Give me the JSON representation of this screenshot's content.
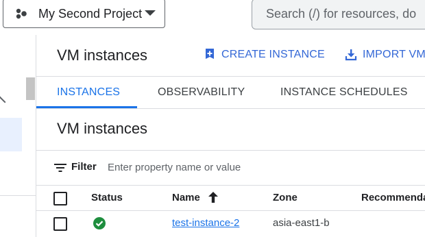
{
  "topbar": {
    "project_name": "My Second Project",
    "search_placeholder": "Search (/) for resources, do"
  },
  "header": {
    "title": "VM instances",
    "actions": {
      "create": "CREATE INSTANCE",
      "import": "IMPORT VM"
    }
  },
  "tabs": [
    {
      "label": "INSTANCES",
      "active": true
    },
    {
      "label": "OBSERVABILITY",
      "active": false
    },
    {
      "label": "INSTANCE SCHEDULES",
      "active": false
    }
  ],
  "section": {
    "title": "VM instances"
  },
  "filter": {
    "label": "Filter",
    "placeholder": "Enter property name or value"
  },
  "table": {
    "columns": [
      "Status",
      "Name",
      "Zone",
      "Recommenda"
    ],
    "sort_column": "Name",
    "rows": [
      {
        "status": "running",
        "name": "test-instance-2",
        "zone": "asia-east1-b"
      }
    ]
  },
  "colors": {
    "accent": "#1a73e8",
    "status_ok": "#1e8e3e"
  },
  "icons": {
    "project": "project-hexagon-icon",
    "create": "add-box-icon",
    "import": "download-icon",
    "filter": "filter-list-icon",
    "sort": "arrow-up-icon",
    "status": "check-circle-icon"
  }
}
